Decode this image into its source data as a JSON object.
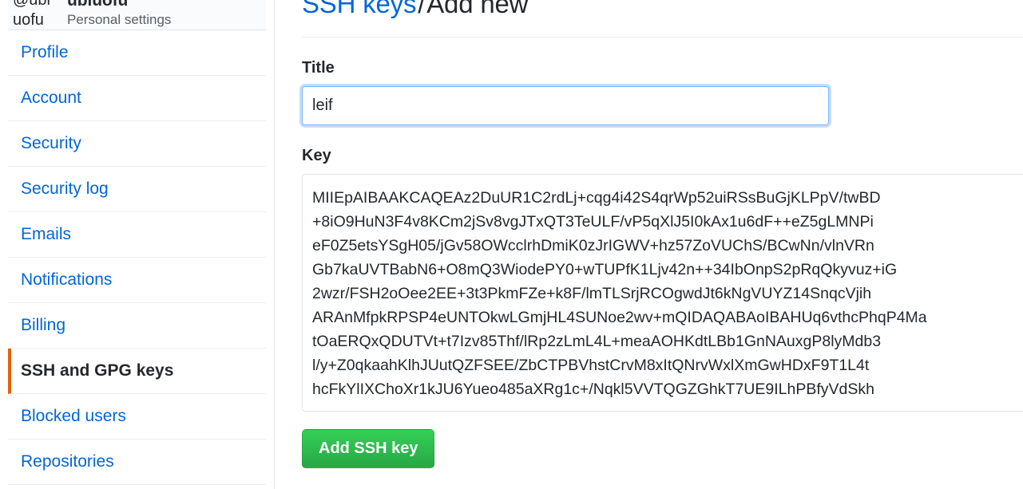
{
  "sidebar": {
    "account": {
      "avatar_alt": "@ubluofu",
      "username": "ubluofu",
      "subtitle": "Personal settings"
    },
    "items": [
      {
        "label": "Profile",
        "selected": false
      },
      {
        "label": "Account",
        "selected": false
      },
      {
        "label": "Security",
        "selected": false
      },
      {
        "label": "Security log",
        "selected": false
      },
      {
        "label": "Emails",
        "selected": false
      },
      {
        "label": "Notifications",
        "selected": false
      },
      {
        "label": "Billing",
        "selected": false
      },
      {
        "label": "SSH and GPG keys",
        "selected": true
      },
      {
        "label": "Blocked users",
        "selected": false
      },
      {
        "label": "Repositories",
        "selected": false
      }
    ]
  },
  "main": {
    "breadcrumb": {
      "link": "SSH keys",
      "separator": "/",
      "current": "Add new"
    },
    "title_field": {
      "label": "Title",
      "value": "leif",
      "placeholder": ""
    },
    "key_field": {
      "label": "Key",
      "value": "MIIEpAIBAAKCAQEAz2DuUR1C2rdLj+cqg4i42S4qrWp52uiRSsBuGjKLPpV/twBD\n+8iO9HuN3F4v8KCm2jSv8vgJTxQT3TeULF/vP5qXlJ5I0kAx1u6dF++eZ5gLMNPi\neF0Z5etsYSgH05/jGv58OWcclrhDmiK0zJrIGWV+hz57ZoVUChS/BCwNn/vlnVRn\nGb7kaUVTBabN6+O8mQ3WiodePY0+wTUPfK1Ljv42n++34IbOnpS2pRqQkyvuz+iG\n2wzr/FSH2oOee2EE+3t3PkmFZe+k8F/lmTLSrjRCOgwdJt6kNgVUYZ14SnqcVjih\nARAnMfpkRPSP4eUNTOkwLGmjHL4SUNoe2wv+mQIDAQABAoIBAHUq6vthcPhqP4Ma\ntOaERQxQDUTVt+t7Izv85Thf/lRp2zLmL4L+meaAOHKdtLBb1GnNAuxgP8lyMdb3\nl/y+Z0qkaahKlhJUutQZFSEE/ZbCTPBVhstCrvM8xItQNrvWxlXmGwHDxF9T1L4t\nhcFkYlIXChoXr1kJU6Yueo485aXRg1c+/Nqkl5VVTQGZGhkT7UE9ILhPBfyVdSkh",
      "placeholder": ""
    },
    "submit_button": "Add SSH key"
  }
}
